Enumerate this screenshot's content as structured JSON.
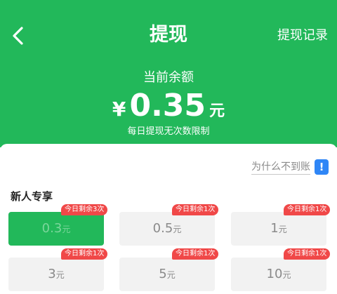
{
  "header": {
    "title": "提现",
    "record_label": "提现记录",
    "balance_label": "当前余额",
    "currency": "¥",
    "balance": "0.35",
    "unit": "元",
    "limit_text": "每日提现无次数限制"
  },
  "help": {
    "label": "为什么不到账",
    "icon": "!"
  },
  "section_title": "新人专享",
  "options": [
    {
      "value": "0.3",
      "unit": "元",
      "badge": "今日剩余3次",
      "selected": true
    },
    {
      "value": "0.5",
      "unit": "元",
      "badge": "今日剩余1次",
      "selected": false
    },
    {
      "value": "1",
      "unit": "元",
      "badge": "今日剩余1次",
      "selected": false
    },
    {
      "value": "3",
      "unit": "元",
      "badge": "今日剩余1次",
      "selected": false
    },
    {
      "value": "5",
      "unit": "元",
      "badge": "今日剩余1次",
      "selected": false
    },
    {
      "value": "10",
      "unit": "元",
      "badge": "今日剩余1次",
      "selected": false
    }
  ],
  "colors": {
    "primary": "#22b85a",
    "badge": "#f04848",
    "info": "#2f86f6"
  }
}
